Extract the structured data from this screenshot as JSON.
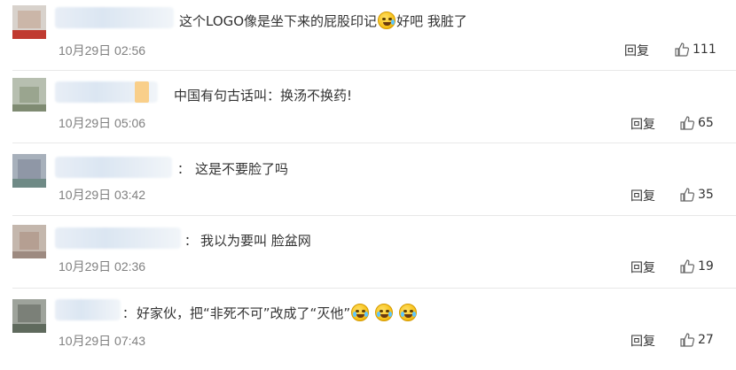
{
  "comments": [
    {
      "text": "这个LOGO像是坐下来的屁股印记",
      "text_after": "好吧 我脏了",
      "emojis": [
        "sweat-emoji"
      ],
      "time": "10月29日 02:56",
      "reply_label": "回复",
      "likes": "111"
    },
    {
      "text": "中国有句古话叫：换汤不换药!",
      "time": "10月29日 05:06",
      "reply_label": "回复",
      "likes": "65"
    },
    {
      "separator": "：",
      "text": "这是不要脸了吗",
      "time": "10月29日 03:42",
      "reply_label": "回复",
      "likes": "35"
    },
    {
      "separator": "：",
      "text": "我以为要叫 脸盆网",
      "time": "10月29日 02:36",
      "reply_label": "回复",
      "likes": "19"
    },
    {
      "separator": "：",
      "text": "好家伙，把“非死不可”改成了“灭他”",
      "emojis": [
        "laugh-cry-emoji",
        "laugh-cry-emoji",
        "laugh-cry-emoji"
      ],
      "time": "10月29日 07:43",
      "reply_label": "回复",
      "likes": "27"
    }
  ],
  "colors": {
    "text": "#333333",
    "time": "#808080",
    "divider": "#e8e8e8"
  },
  "icons": {
    "like": "thumbs-up-icon"
  }
}
